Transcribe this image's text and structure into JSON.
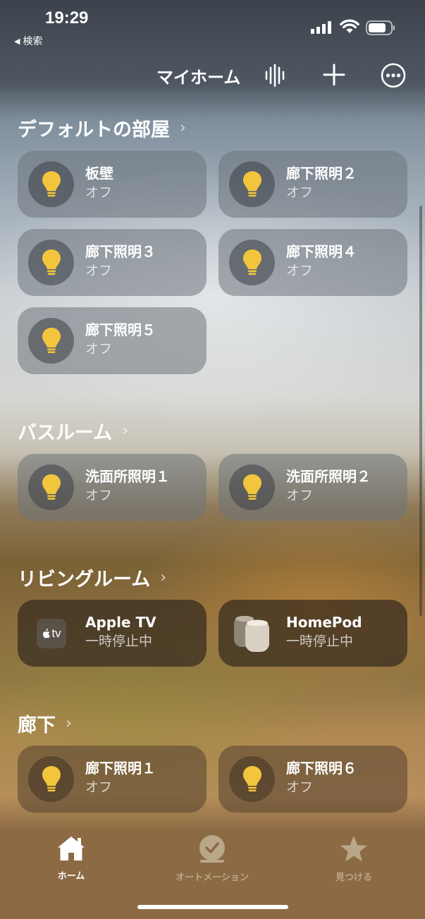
{
  "status_bar": {
    "time": "19:29",
    "back_label": "検索",
    "back_icon": "◀"
  },
  "header": {
    "title": "マイホーム",
    "add_icon": "plus-icon",
    "more_icon": "ellipsis-circle-icon",
    "voice_icon": "waveform-icon"
  },
  "sections": [
    {
      "title": "デフォルトの部屋",
      "chevron": "›",
      "tiles": [
        {
          "name": "板壁",
          "state": "オフ",
          "icon": "lightbulb-icon"
        },
        {
          "name": "廊下照明２",
          "state": "オフ",
          "icon": "lightbulb-icon"
        },
        {
          "name": "廊下照明３",
          "state": "オフ",
          "icon": "lightbulb-icon"
        },
        {
          "name": "廊下照明４",
          "state": "オフ",
          "icon": "lightbulb-icon"
        },
        {
          "name": "廊下照明５",
          "state": "オフ",
          "icon": "lightbulb-icon"
        }
      ]
    },
    {
      "title": "バスルーム",
      "chevron": "›",
      "tiles": [
        {
          "name": "洗面所照明１",
          "state": "オフ",
          "icon": "lightbulb-icon"
        },
        {
          "name": "洗面所照明２",
          "state": "オフ",
          "icon": "lightbulb-icon"
        }
      ]
    },
    {
      "title": "リビングルーム",
      "chevron": "›",
      "tiles": [
        {
          "name": "Apple TV",
          "state": "一時停止中",
          "icon": "appletv-icon",
          "icon_text": "tv"
        },
        {
          "name": "HomePod",
          "state": "一時停止中",
          "icon": "homepod-icon"
        }
      ]
    },
    {
      "title": "廊下",
      "chevron": "›",
      "tiles": [
        {
          "name": "廊下照明１",
          "state": "オフ",
          "icon": "lightbulb-icon"
        },
        {
          "name": "廊下照明６",
          "state": "オフ",
          "icon": "lightbulb-icon"
        }
      ]
    }
  ],
  "tab_bar": {
    "tabs": [
      {
        "label": "ホーム",
        "icon": "house-icon",
        "active": true
      },
      {
        "label": "オートメーション",
        "icon": "clock-icon",
        "active": false
      },
      {
        "label": "見つける",
        "icon": "star-icon",
        "active": false
      }
    ]
  },
  "colors": {
    "bulb": "#f2c53d",
    "active_tab": "#ffffff",
    "inactive_tab": "#b9a78a"
  }
}
